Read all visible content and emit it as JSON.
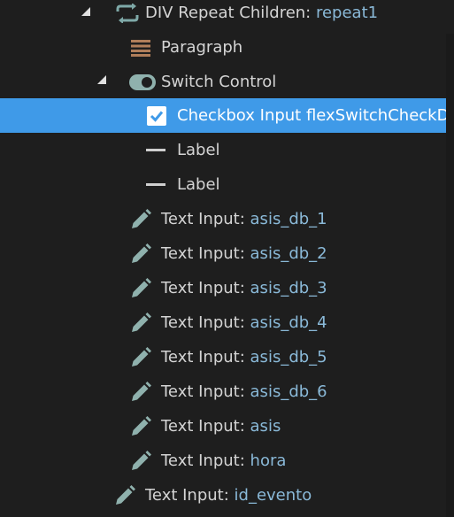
{
  "tree": {
    "repeat": {
      "label": "DIV Repeat Children: ",
      "value": "repeat1"
    },
    "paragraph": {
      "label": "Paragraph"
    },
    "switch": {
      "label": "Switch Control"
    },
    "checkbox": {
      "label": "Checkbox Input flexSwitchCheckDefa"
    },
    "label1": {
      "label": "Label"
    },
    "label2": {
      "label": "Label"
    },
    "inputs": [
      {
        "label": "Text Input: ",
        "value": "asis_db_1"
      },
      {
        "label": "Text Input: ",
        "value": "asis_db_2"
      },
      {
        "label": "Text Input: ",
        "value": "asis_db_3"
      },
      {
        "label": "Text Input: ",
        "value": "asis_db_4"
      },
      {
        "label": "Text Input: ",
        "value": "asis_db_5"
      },
      {
        "label": "Text Input: ",
        "value": "asis_db_6"
      },
      {
        "label": "Text Input: ",
        "value": "asis"
      },
      {
        "label": "Text Input: ",
        "value": "hora"
      }
    ],
    "outer_input": {
      "label": "Text Input: ",
      "value": "id_evento"
    }
  },
  "colors": {
    "background": "#1e1e1e",
    "selection": "#3f9ae8",
    "value_text": "#8ab9d8",
    "repeat_icon": "#7fa9a8",
    "paragraph_icon": "#b07e5a",
    "pencil_icon": "#8fb1ad"
  },
  "icons": {
    "repeat": "repeat-icon",
    "paragraph": "paragraph-icon",
    "switch": "toggle-switch-icon",
    "checkbox": "checkbox-checked-icon",
    "label": "dash-icon",
    "text_input": "pencil-icon"
  }
}
